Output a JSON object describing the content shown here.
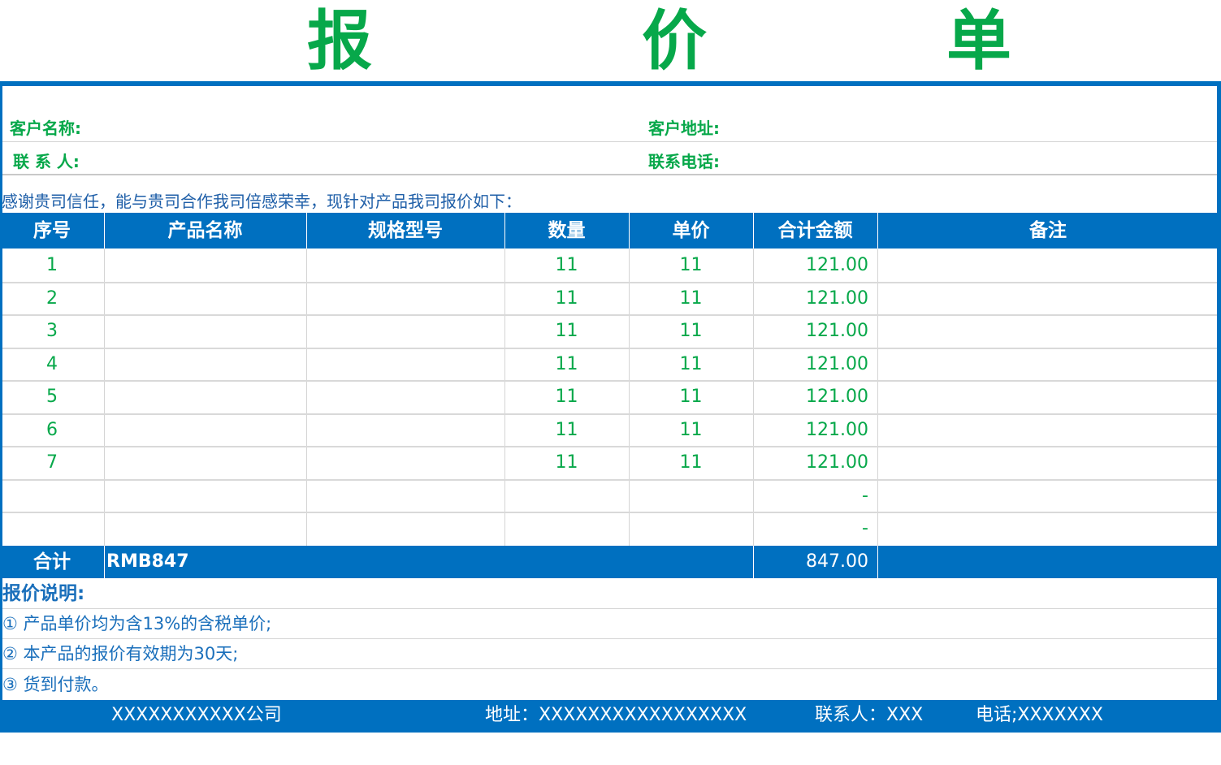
{
  "title": {
    "c1": "报",
    "c2": "价",
    "c3": "单"
  },
  "info": {
    "customer_name_label": "客户名称:",
    "customer_address_label": "客户地址:",
    "contact_label": "联 系 人:",
    "phone_label": "联系电话:"
  },
  "greeting": "感谢贵司信任，能与贵司合作我司倍感荣幸，现针对产品我司报价如下：",
  "table": {
    "headers": [
      "序号",
      "产品名称",
      "规格型号",
      "数量",
      "单价",
      "合计金额",
      "备注"
    ],
    "rows": [
      {
        "no": "1",
        "name": "",
        "spec": "",
        "qty": "11",
        "price": "11",
        "amount": "121.00",
        "remark": ""
      },
      {
        "no": "2",
        "name": "",
        "spec": "",
        "qty": "11",
        "price": "11",
        "amount": "121.00",
        "remark": ""
      },
      {
        "no": "3",
        "name": "",
        "spec": "",
        "qty": "11",
        "price": "11",
        "amount": "121.00",
        "remark": ""
      },
      {
        "no": "4",
        "name": "",
        "spec": "",
        "qty": "11",
        "price": "11",
        "amount": "121.00",
        "remark": ""
      },
      {
        "no": "5",
        "name": "",
        "spec": "",
        "qty": "11",
        "price": "11",
        "amount": "121.00",
        "remark": ""
      },
      {
        "no": "6",
        "name": "",
        "spec": "",
        "qty": "11",
        "price": "11",
        "amount": "121.00",
        "remark": ""
      },
      {
        "no": "7",
        "name": "",
        "spec": "",
        "qty": "11",
        "price": "11",
        "amount": "121.00",
        "remark": ""
      },
      {
        "no": "",
        "name": "",
        "spec": "",
        "qty": "",
        "price": "",
        "amount": "-",
        "remark": ""
      },
      {
        "no": "",
        "name": "",
        "spec": "",
        "qty": "",
        "price": "",
        "amount": "-",
        "remark": ""
      }
    ],
    "total_label": "合计",
    "total_rmb": "RMB847",
    "total_amount": "847.00"
  },
  "notes": {
    "title": "报价说明:",
    "items": [
      "①  产品单价均为含13%的含税单价;",
      "②  本产品的报价有效期为30天;",
      "③  货到付款。"
    ]
  },
  "footer": {
    "company": "XXXXXXXXXXX公司",
    "address": "地址：XXXXXXXXXXXXXXXXX",
    "contact": "联系人：XXX",
    "phone": "电话;XXXXXXX"
  },
  "colors": {
    "accent": "#0070c0",
    "green": "#07a84a",
    "note_text": "#1a6fbb"
  }
}
